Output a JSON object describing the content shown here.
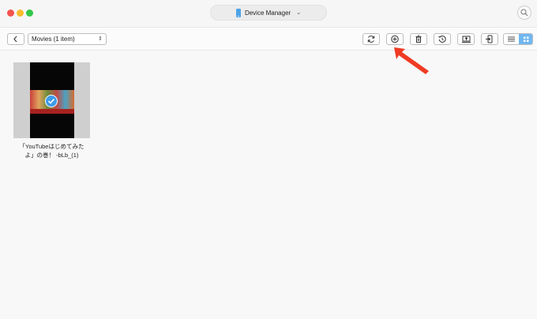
{
  "window": {
    "title": "Device Manager",
    "title_icon": "phone-icon",
    "dropdown_icon": "chevron-down-icon",
    "search_icon": "search-icon"
  },
  "toolbar": {
    "back_icon": "chevron-left-icon",
    "category_select": "Movies (1 item)",
    "tools": [
      "refresh-icon",
      "add-icon",
      "trash-icon",
      "restore-icon",
      "export-icon",
      "to-device-icon"
    ],
    "view_modes": [
      "list-view-icon",
      "grid-view-icon"
    ],
    "active_view": "grid"
  },
  "items": [
    {
      "caption_line1": "「YouTubeはじめてみた",
      "caption_line2": "よ」の巻！ -bLb_(1)",
      "selected": true
    }
  ],
  "colors": {
    "accent": "#3d9bea",
    "arrow": "#ef3b24",
    "close": "#f4544d",
    "minimize": "#f7bb2f",
    "zoom": "#34c748"
  }
}
